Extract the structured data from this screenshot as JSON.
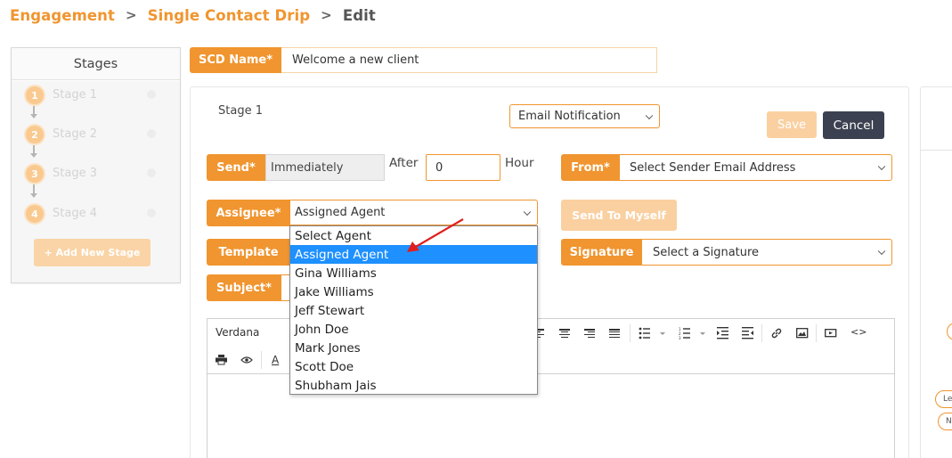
{
  "breadcrumb": {
    "items": [
      "Engagement",
      "Single Contact Drip"
    ],
    "separator": ">",
    "current": "Edit"
  },
  "stages_panel": {
    "title": "Stages",
    "stages": [
      {
        "num": "1",
        "label": "Stage 1"
      },
      {
        "num": "2",
        "label": "Stage 2"
      },
      {
        "num": "3",
        "label": "Stage 3"
      },
      {
        "num": "4",
        "label": "Stage 4"
      }
    ],
    "add_label": "+ Add New Stage"
  },
  "scd": {
    "label": "SCD Name*",
    "value": "Welcome a new client"
  },
  "stage_form": {
    "title": "Stage 1",
    "notification_type": "Email Notification",
    "save_label": "Save",
    "cancel_label": "Cancel",
    "send_label": "Send*",
    "send_value": "Immediately",
    "after_label": "After",
    "after_value": "0",
    "hour_label": "Hour",
    "from_label": "From*",
    "from_value": "Select Sender Email Address",
    "assignee_label": "Assignee*",
    "assignee_value": "Assigned Agent",
    "send_to_myself_label": "Send To Myself",
    "template_label": "Template",
    "signature_label": "Signature",
    "signature_value": "Select a Signature",
    "subject_label": "Subject*"
  },
  "assignee_dropdown": {
    "options": [
      "Select Agent",
      "Assigned Agent",
      "Gina Williams",
      "Jake Williams",
      "Jeff Stewart",
      "John Doe",
      "Mark Jones",
      "Scott Doe",
      "Shubham Jais"
    ],
    "selected_index": 1
  },
  "editor": {
    "font_name": "Verdana",
    "font_color_glyph": "A",
    "code_glyph": "<>"
  },
  "right_panel": {
    "chips": [
      "Le",
      "N"
    ]
  },
  "colors": {
    "accent": "#f0952f",
    "accent_light": "#fad0a1",
    "dark_button": "#3b4150",
    "selection": "#1e90ff",
    "arrow": "#e01e1e"
  }
}
